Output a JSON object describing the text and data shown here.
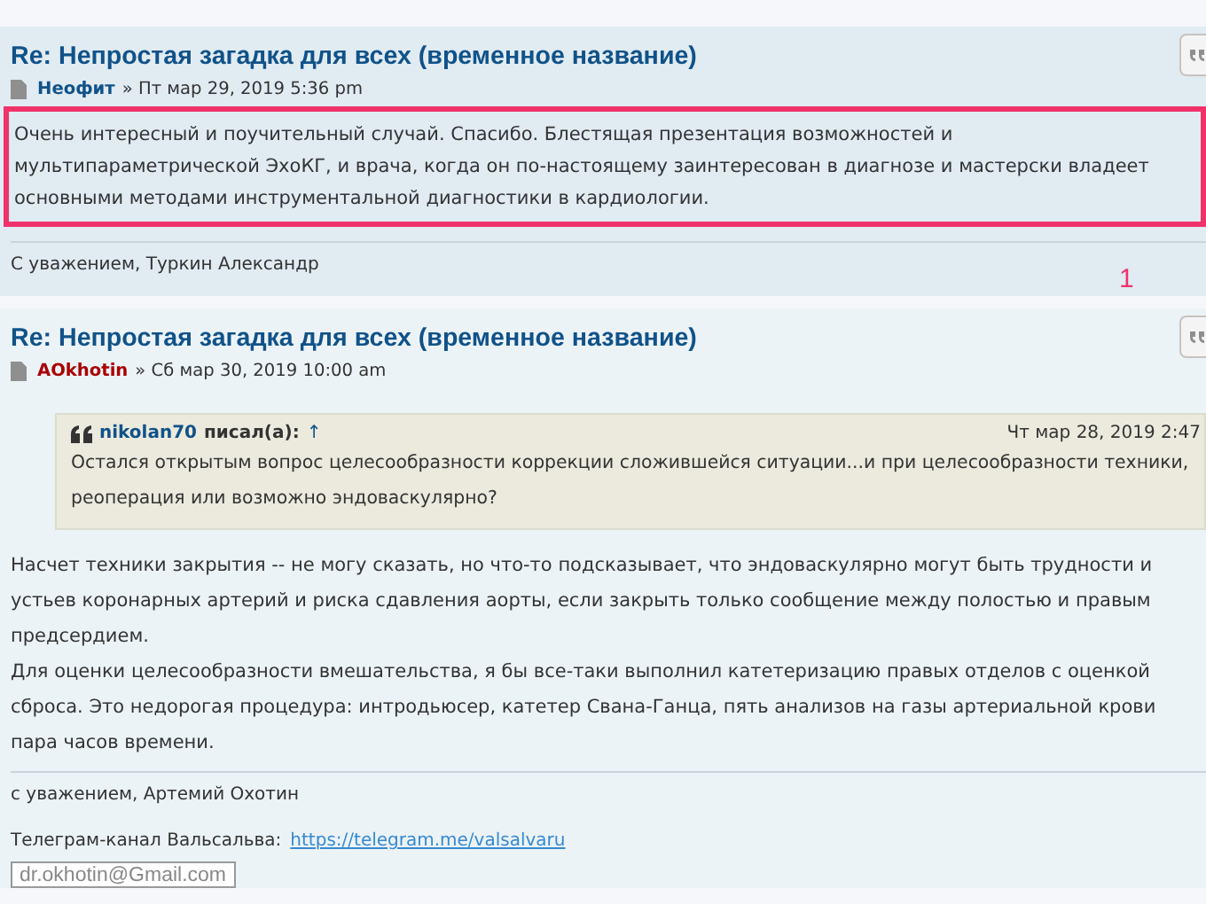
{
  "posts": [
    {
      "title": "Re: Непростая загадка для всех (временное название)",
      "author": "Неофит",
      "color": "#105289",
      "date": "» Пт мар 29, 2019 5:36 pm",
      "highlighted": true,
      "annotation": "1",
      "body": [
        "Очень интересный и поучительный случай. Спасибо. Блестящая презентация возможностей и",
        "мультипараметрической ЭхоКГ, и врача, когда он по-настоящему заинтересован в диагнозе и мастерски владеет",
        "основными методами инструментальной диагностики в кардиологии."
      ],
      "signature": [
        "С уважением, Туркин Александр"
      ]
    },
    {
      "title": "Re: Непростая загадка для всех (временное название)",
      "author": "AOkhotin",
      "color": "#aa0000",
      "date": "» Сб мар 30, 2019 10:00 am",
      "quote": {
        "author": "nikolan70",
        "wrote": "писал(а):",
        "arrow": "↑",
        "date": "Чт мар 28, 2019 2:47",
        "lines": [
          "Остался открытым вопрос целесообразности коррекции сложившейся ситуации...и при целесообразности техники,",
          "реоперация или возможно эндоваскулярно?"
        ]
      },
      "paragraphs": [
        [
          "Насчет техники закрытия -- не могу сказать, но что-то подсказывает, что эндоваскулярно могут быть трудности и",
          "устьев коронарных артерий и риска сдавления аорты, если закрыть только сообщение между полостью и правым",
          "предсердием."
        ],
        [
          "Для оценки целесообразности вмешательства, я бы все-таки выполнил катетеризацию правых отделов с оценкой",
          "сброса. Это недорогая процедура: интродьюсер, катетер Свана-Ганца, пять анализов на газы артериальной крови",
          "пара часов времени."
        ]
      ],
      "signature": [
        "с уважением, Артемий Охотин"
      ],
      "channel": {
        "label": "Телеграм-канал Вальсальва:",
        "link": "https://telegram.me/valsalvaru"
      },
      "email_badge": "dr.okhotin@Gmail.com"
    }
  ]
}
